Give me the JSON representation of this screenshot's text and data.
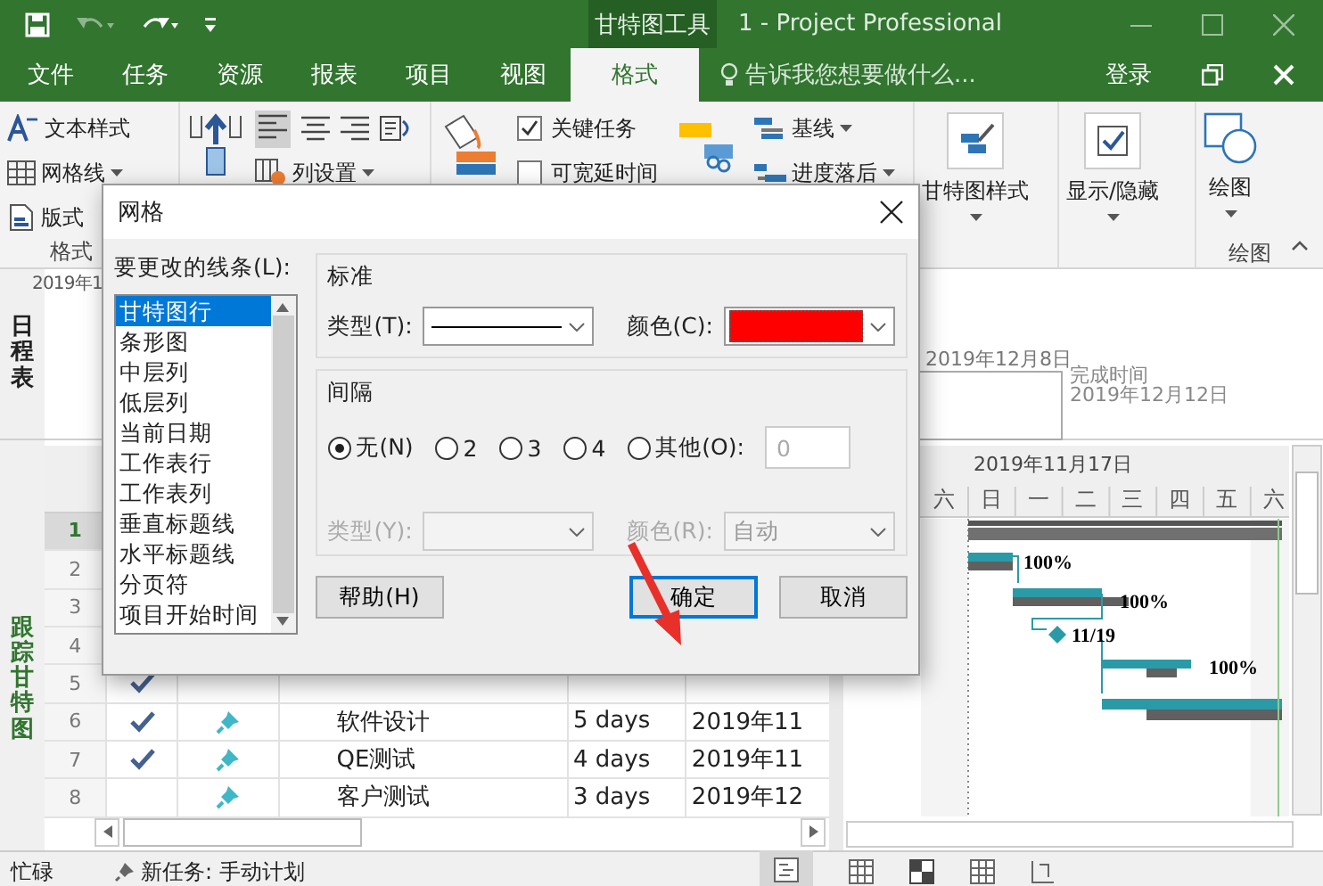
{
  "title_bar": {
    "context_tab": "甘特图工具",
    "title": "1 - Project Professional"
  },
  "menu_tabs": [
    {
      "label": "文件",
      "selected": false
    },
    {
      "label": "任务",
      "selected": false
    },
    {
      "label": "资源",
      "selected": false
    },
    {
      "label": "报表",
      "selected": false
    },
    {
      "label": "项目",
      "selected": false
    },
    {
      "label": "视图",
      "selected": false
    },
    {
      "label": "格式",
      "selected": true
    }
  ],
  "tell_me": {
    "placeholder": "告诉我您想要做什么..."
  },
  "sign_in": "登录",
  "ribbon": {
    "text_styles": "文本样式",
    "gridlines": "网格线",
    "layout": "版式",
    "format_group_label": "格式",
    "column_settings": "列设置",
    "checkboxes": [
      {
        "label": "关键任务",
        "checked": true
      },
      {
        "label": "可宽延时间",
        "checked": false
      }
    ],
    "baseline": "基线",
    "slippage": "进度落后",
    "gantt_style": "甘特图样式",
    "show_hide": "显示/隐藏",
    "drawing": "绘图",
    "drawing_group_label": "绘图"
  },
  "timeline": {
    "label": "日程表",
    "start_date": "2019年1",
    "date_mark": "2019年12月8日",
    "finish_label": "完成时间",
    "finish_date": "2019年12月12日"
  },
  "table": {
    "view_label": "跟踪甘特图",
    "rows": [
      {
        "number": "1",
        "selected": true
      },
      {
        "number": "2",
        "selected": false
      },
      {
        "number": "3",
        "selected": false
      },
      {
        "number": "4",
        "selected": false
      },
      {
        "number": "5",
        "selected": false,
        "done": true
      },
      {
        "number": "6",
        "selected": false,
        "done": true,
        "name": "软件设计",
        "duration": "5 days",
        "start": "2019年11"
      },
      {
        "number": "7",
        "selected": false,
        "done": true,
        "name": "QE测试",
        "duration": "4 days",
        "start": "2019年11"
      },
      {
        "number": "8",
        "selected": false,
        "done": false,
        "name": "客户测试",
        "duration": "3 days",
        "start": "2019年12"
      }
    ]
  },
  "gantt": {
    "date_header": "2019年11月17日",
    "days": [
      "六",
      "日",
      "一",
      "二",
      "三",
      "四",
      "五",
      "六"
    ],
    "bar_labels": [
      "100%",
      "100%",
      "11/19",
      "100%"
    ]
  },
  "status_bar": {
    "mode": "忙碌",
    "new_task": "新任务: 手动计划"
  },
  "dialog": {
    "title": "网格",
    "list_label": "要更改的线条(L):",
    "line_items": [
      {
        "label": "甘特图行",
        "selected": true
      },
      {
        "label": "条形图",
        "selected": false
      },
      {
        "label": "中层列",
        "selected": false
      },
      {
        "label": "低层列",
        "selected": false
      },
      {
        "label": "当前日期",
        "selected": false
      },
      {
        "label": "工作表行",
        "selected": false
      },
      {
        "label": "工作表列",
        "selected": false
      },
      {
        "label": "垂直标题线",
        "selected": false
      },
      {
        "label": "水平标题线",
        "selected": false
      },
      {
        "label": "分页符",
        "selected": false
      },
      {
        "label": "项目开始时间",
        "selected": false
      }
    ],
    "standard": {
      "label": "标准",
      "type_label": "类型(T):",
      "color_label": "颜色(C):",
      "color": "#ff0000"
    },
    "interval": {
      "label": "间隔",
      "options": [
        {
          "label": "无(N)",
          "selected": true
        },
        {
          "label": "2",
          "selected": false
        },
        {
          "label": "3",
          "selected": false
        },
        {
          "label": "4",
          "selected": false
        },
        {
          "label": "其他(O):",
          "selected": false
        }
      ],
      "other_value": "0",
      "type_label": "类型(Y):",
      "color_label": "颜色(R):",
      "color_value": "自动"
    },
    "buttons": [
      {
        "label": "帮助(H)",
        "default": false
      },
      {
        "label": "确定",
        "default": true
      },
      {
        "label": "取消",
        "default": false
      }
    ]
  }
}
